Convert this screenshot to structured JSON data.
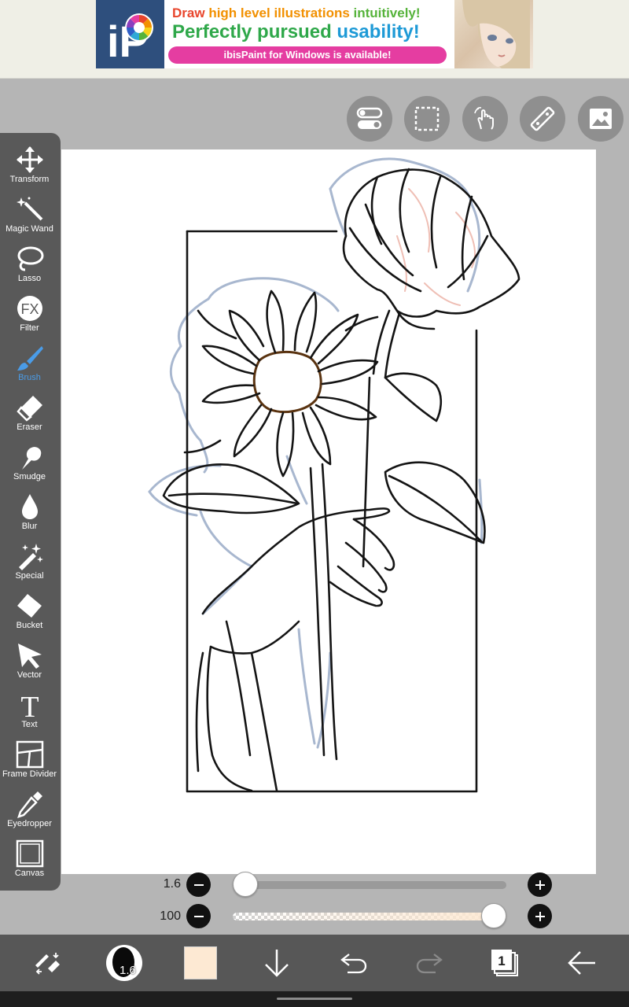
{
  "ad": {
    "line1": {
      "w1": "Draw",
      "w2": "high level illustrations",
      "w3": "intuitively!"
    },
    "line2": {
      "w4": "Perfectly pursued",
      "w5": "usability!"
    },
    "pill": "ibisPaint for Windows is available!",
    "logo_letters": "iP"
  },
  "top_toolbar": [
    "toggle-icon",
    "selection-icon",
    "hand-touch-icon",
    "ruler-icon",
    "image-reference-icon"
  ],
  "tools": [
    {
      "label": "Transform",
      "icon": "transform-icon"
    },
    {
      "label": "Magic Wand",
      "icon": "magic-wand-icon"
    },
    {
      "label": "Lasso",
      "icon": "lasso-icon"
    },
    {
      "label": "Filter",
      "icon": "filter-icon",
      "glyph": "FX"
    },
    {
      "label": "Brush",
      "icon": "brush-icon",
      "active": true
    },
    {
      "label": "Eraser",
      "icon": "eraser-icon"
    },
    {
      "label": "Smudge",
      "icon": "smudge-icon"
    },
    {
      "label": "Blur",
      "icon": "blur-icon"
    },
    {
      "label": "Special",
      "icon": "special-icon"
    },
    {
      "label": "Bucket",
      "icon": "bucket-icon"
    },
    {
      "label": "Vector",
      "icon": "vector-icon"
    },
    {
      "label": "Text",
      "icon": "text-icon",
      "glyph": "T"
    },
    {
      "label": "Frame Divider",
      "icon": "frame-divider-icon"
    },
    {
      "label": "Eyedropper",
      "icon": "eyedropper-icon"
    },
    {
      "label": "Canvas",
      "icon": "canvas-icon"
    }
  ],
  "sliders": {
    "size": {
      "value": "1.6",
      "fraction": 0.0
    },
    "opacity": {
      "value": "100",
      "fraction": 1.0
    }
  },
  "bottom_bar": {
    "brush_size_badge": "1.6",
    "current_color": "#fde9d3",
    "layer_count": "1"
  },
  "colors": {
    "accent": "#4a9ce8",
    "panel": "#595959",
    "workspace": "#b5b5b5",
    "sketch_blue": "#a8b7cf"
  }
}
